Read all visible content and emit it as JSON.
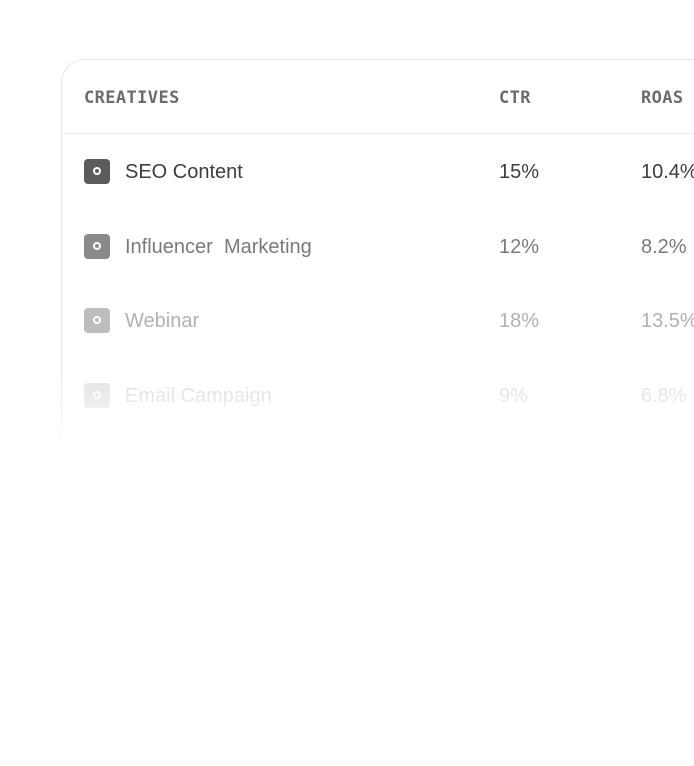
{
  "table": {
    "columns": {
      "creatives": "CREATIVES",
      "ctr": "CTR",
      "roas": "ROAS"
    },
    "rows": [
      {
        "icon": "creative-thumbnail-icon",
        "name": "SEO Content",
        "ctr": "15%",
        "roas": "10.4%"
      },
      {
        "icon": "creative-thumbnail-icon",
        "name": "Influencer  Marketing",
        "ctr": "12%",
        "roas": "8.2%"
      },
      {
        "icon": "creative-thumbnail-icon",
        "name": "Webinar",
        "ctr": "18%",
        "roas": "13.5%"
      },
      {
        "icon": "creative-thumbnail-icon",
        "name": "Email Campaign",
        "ctr": "9%",
        "roas": "6.8%"
      }
    ]
  },
  "colors": {
    "header_text": "#6b6b70",
    "row_text_primary": "#3d3d40",
    "card_border": "#e6e6e6"
  }
}
